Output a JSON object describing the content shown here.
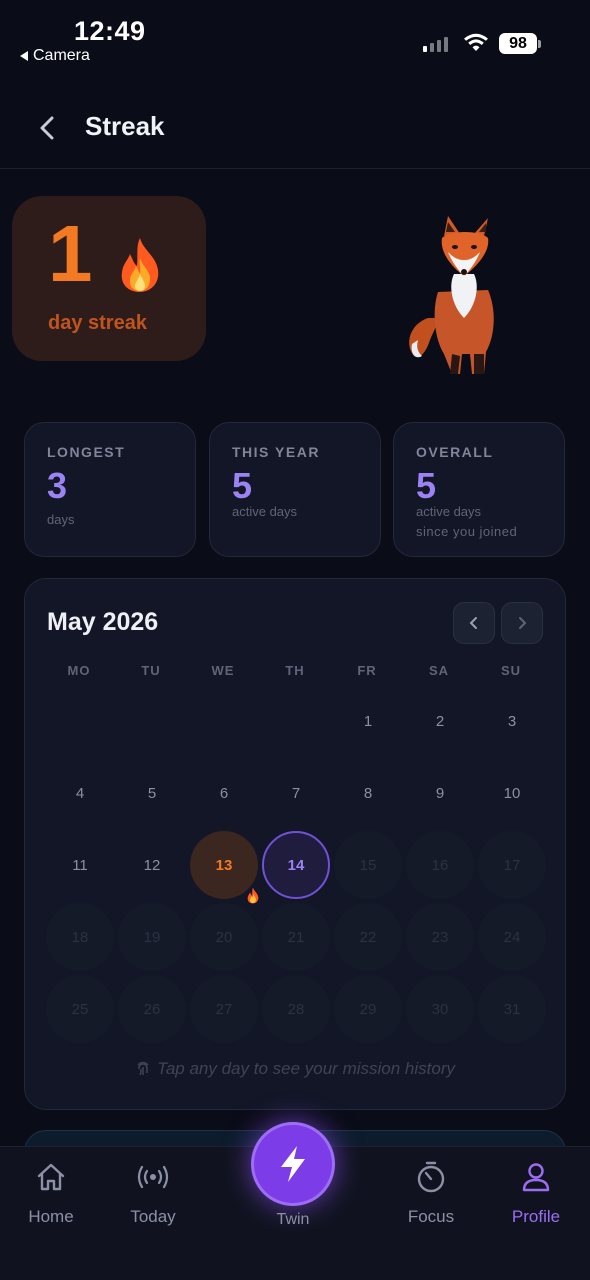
{
  "status_bar": {
    "time": "12:49",
    "back_app": "Camera",
    "battery": "98"
  },
  "header": {
    "title": "Streak"
  },
  "streak": {
    "count": "1",
    "label": "day streak"
  },
  "stats": [
    {
      "label": "LONGEST",
      "value": "3",
      "sub": "days",
      "sub2": ""
    },
    {
      "label": "THIS YEAR",
      "value": "5",
      "sub": "active days",
      "sub2": ""
    },
    {
      "label": "OVERALL",
      "value": "5",
      "sub": "active days",
      "sub2": "since you joined"
    }
  ],
  "calendar": {
    "title": "May 2026",
    "weekdays": [
      "MO",
      "TU",
      "WE",
      "TH",
      "FR",
      "SA",
      "SU"
    ],
    "first_weekday_index": 4,
    "days_in_month": 31,
    "streak_day": 13,
    "today": 14,
    "hint": "Tap any day to see your mission history"
  },
  "tabbar": {
    "home": "Home",
    "today": "Today",
    "twin": "Twin",
    "focus": "Focus",
    "profile": "Profile"
  },
  "colors": {
    "accent_purple": "#9b83f4",
    "streak_orange": "#f37a22",
    "background": "#0a0c18"
  }
}
